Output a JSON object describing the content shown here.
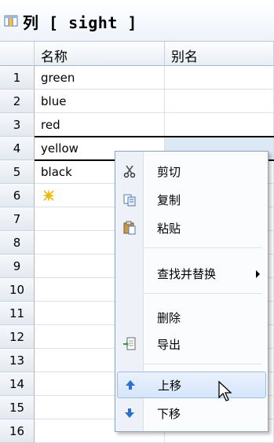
{
  "window": {
    "title": "列 [ sight ]"
  },
  "columns": [
    "名称",
    "别名"
  ],
  "rows": [
    {
      "num": "1",
      "name": "green",
      "alias": ""
    },
    {
      "num": "2",
      "name": "blue",
      "alias": ""
    },
    {
      "num": "3",
      "name": "red",
      "alias": ""
    },
    {
      "num": "4",
      "name": "yellow",
      "alias": ""
    },
    {
      "num": "5",
      "name": "black",
      "alias": ""
    },
    {
      "num": "6",
      "name": "",
      "alias": ""
    },
    {
      "num": "7",
      "name": "",
      "alias": ""
    },
    {
      "num": "8",
      "name": "",
      "alias": ""
    },
    {
      "num": "9",
      "name": "",
      "alias": ""
    },
    {
      "num": "10",
      "name": "",
      "alias": ""
    },
    {
      "num": "11",
      "name": "",
      "alias": ""
    },
    {
      "num": "12",
      "name": "",
      "alias": ""
    },
    {
      "num": "13",
      "name": "",
      "alias": ""
    },
    {
      "num": "14",
      "name": "",
      "alias": ""
    },
    {
      "num": "15",
      "name": "",
      "alias": ""
    },
    {
      "num": "16",
      "name": "",
      "alias": ""
    }
  ],
  "context_menu": {
    "cut": "剪切",
    "copy": "复制",
    "paste": "粘贴",
    "find_replace": "查找并替换",
    "delete": "删除",
    "export": "导出",
    "move_up": "上移",
    "move_down": "下移"
  },
  "icons": {
    "title": "table-column-icon",
    "new_row": "sparkle-icon",
    "cursor": "mouse-pointer-icon"
  }
}
